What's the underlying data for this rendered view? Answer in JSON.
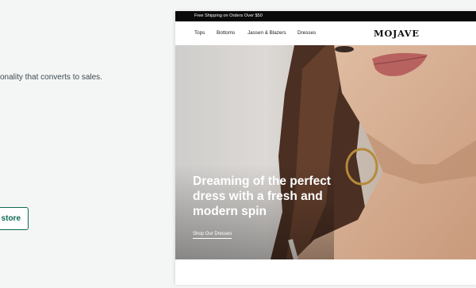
{
  "left_panel": {
    "description_fragment": "onality that converts to sales.",
    "store_button_label": "store"
  },
  "store_preview": {
    "announcement": "Free Shipping on Orders Over $50",
    "nav_links": [
      "Tops",
      "Bottoms",
      "Jassen & Blazers",
      "Dresses"
    ],
    "brand": "MOJAVE",
    "hero": {
      "headline": "Dreaming of the perfect dress with a fresh and modern spin",
      "cta": "Shop Our Dresses"
    }
  },
  "colors": {
    "page_background": "#f4f6f5",
    "accent_green": "#0d6b52",
    "announcement_bar": "#0a0a0a",
    "hero_text": "#ffffff"
  }
}
